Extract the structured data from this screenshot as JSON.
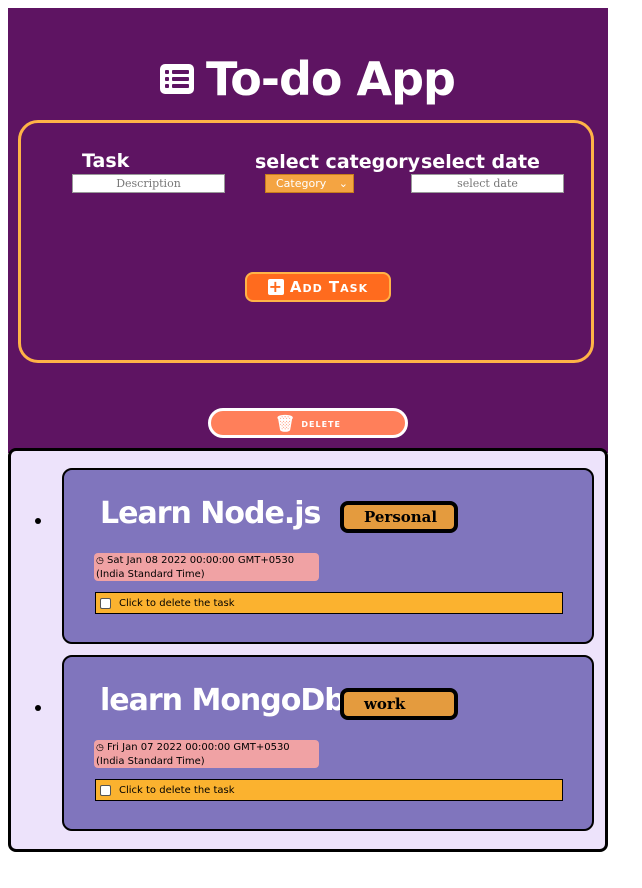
{
  "header": {
    "title": "To-do App",
    "icon": "list-icon"
  },
  "form": {
    "task_label": "Task",
    "task_placeholder": "Description",
    "category_label": "select category",
    "category_value": "Category",
    "date_label": "select date",
    "date_placeholder": "select date",
    "add_button": "Add Task"
  },
  "delete_button": "delete",
  "tasks": [
    {
      "title": "Learn Node.js",
      "category": "Personal",
      "date": "Sat Jan 08 2022 00:00:00 GMT+0530 (India Standard Time)",
      "delete_text": "Click to delete the task"
    },
    {
      "title": "learn MongoDb",
      "category": "work",
      "date": "Fri Jan 07 2022 00:00:00 GMT+0530 (India Standard Time)",
      "delete_text": "Click to delete the task"
    }
  ],
  "colors": {
    "background": "#5e1462",
    "accent": "#ffb347",
    "card": "#8075bd",
    "badge": "#e49b3e",
    "date": "#f0a2a4",
    "delete_row": "#fbb22f"
  }
}
